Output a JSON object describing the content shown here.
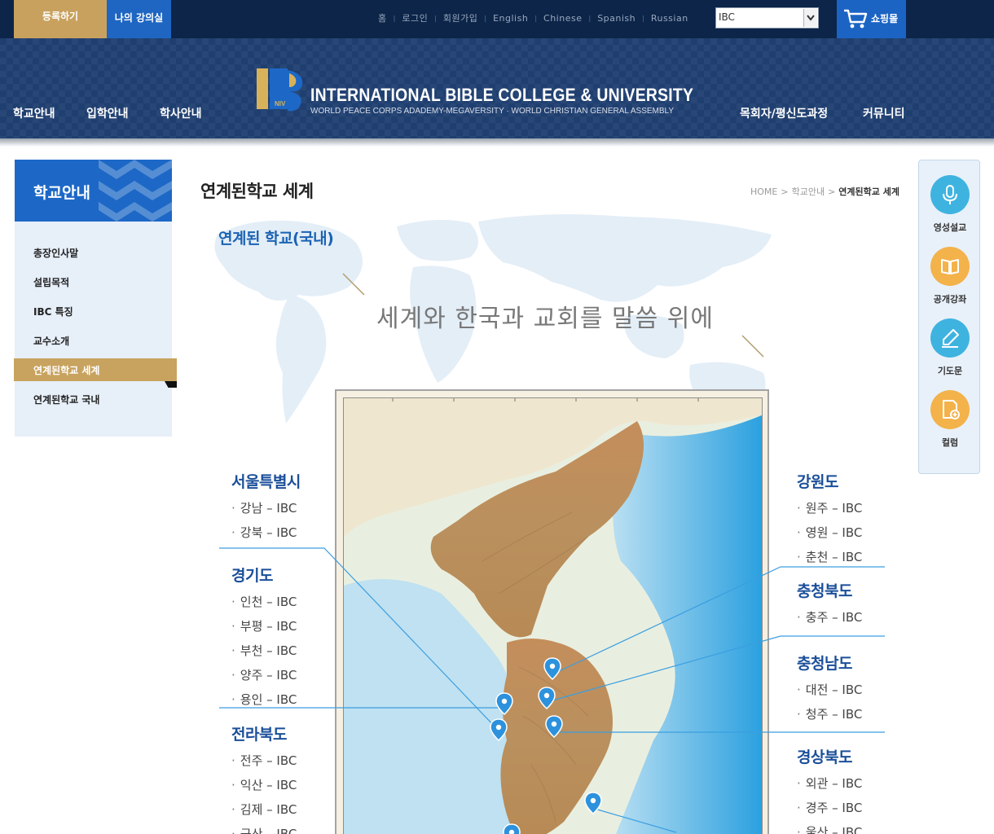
{
  "topbar": {
    "register_label": "등록하기",
    "my_lecture_label": "나의 강의실",
    "util_links": [
      "홈",
      "로그인",
      "회원가입",
      "English",
      "Chinese",
      "Spanish",
      "Russian"
    ],
    "site_select_value": "IBC",
    "shop_label": "쇼핑몰"
  },
  "header": {
    "gnb_left": [
      "학교안내",
      "입학안내",
      "학사안내"
    ],
    "gnb_right": [
      "목회자/평신도과정",
      "커뮤니티"
    ],
    "logo_title": "INTERNATIONAL BIBLE COLLEGE & UNIVERSITY",
    "logo_sub": "WORLD PEACE CORPS ADADEMY-MEGAVERSITY · WORLD CHRISTIAN GENERAL ASSEMBLY",
    "logo_mark_text": "IBC",
    "logo_mark_small": "NIV"
  },
  "sidebar": {
    "title": "학교안내",
    "items": [
      "총장인사말",
      "설립목적",
      "IBC 특징",
      "교수소개",
      "연계된학교 세계",
      "연계된학교 국내"
    ],
    "active_index": 4
  },
  "content": {
    "page_title": "연계된학교 세계",
    "breadcrumb": [
      "HOME",
      "학교안내",
      "연계된학교 세계"
    ],
    "section_title": "연계된 학교(국내)",
    "slogan": "세계와 한국과 교회를 말씀 위에"
  },
  "regions_left": [
    {
      "name": "서울특별시",
      "entries": [
        "강남 – IBC",
        "강북 – IBC"
      ]
    },
    {
      "name": "경기도",
      "entries": [
        "인천 – IBC",
        "부평 – IBC",
        "부천 – IBC",
        "양주 – IBC",
        "용인 – IBC"
      ]
    },
    {
      "name": "전라북도",
      "entries": [
        "전주 – IBC",
        "익산 – IBC",
        "김제 – IBC",
        "군산 – IBC"
      ]
    }
  ],
  "regions_right": [
    {
      "name": "강원도",
      "entries": [
        "원주 – IBC",
        "영원 – IBC",
        "춘천 – IBC"
      ]
    },
    {
      "name": "충청북도",
      "entries": [
        "충주 – IBC"
      ]
    },
    {
      "name": "충청남도",
      "entries": [
        "대전 – IBC",
        "청주 – IBC"
      ]
    },
    {
      "name": "경상북도",
      "entries": [
        "외관 – IBC",
        "경주 – IBC",
        "울산 – IBC"
      ]
    }
  ],
  "quick_menu": [
    {
      "label": "영성설교",
      "icon": "microphone-icon",
      "color": "#3fb3e0"
    },
    {
      "label": "공개강좌",
      "icon": "book-icon",
      "color": "#f3b24a"
    },
    {
      "label": "기도문",
      "icon": "pen-icon",
      "color": "#3fb3e0"
    },
    {
      "label": "컬럼",
      "icon": "document-add-icon",
      "color": "#f3b24a"
    }
  ],
  "colors": {
    "topbar": "#0c2549",
    "header": "#1f3f70",
    "accent_gold": "#c8a35f",
    "accent_blue": "#1d68c6",
    "region_title": "#1b4f9a",
    "connector": "#3b9ee0"
  }
}
